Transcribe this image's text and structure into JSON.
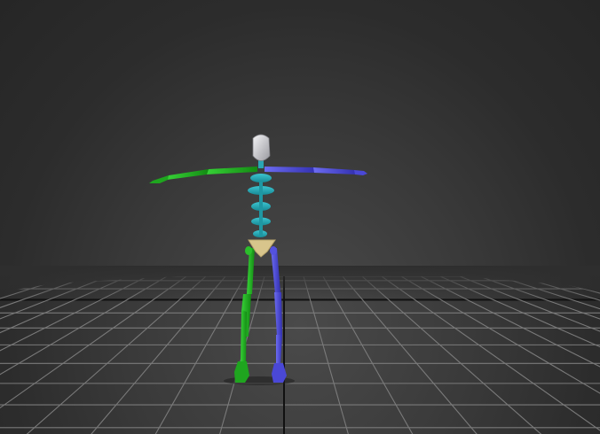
{
  "viewport": {
    "background_center": "#4a4a4a",
    "background_edge": "#262626",
    "grid_color": "#7a7a7a",
    "grid_axis_color": "#111111"
  },
  "biped": {
    "head_color": "#d8d8dc",
    "spine_color": "#2aa6b3",
    "pelvis_color": "#d8c58c",
    "left_side_color": "#1fae1f",
    "right_side_color": "#4a48d6"
  }
}
